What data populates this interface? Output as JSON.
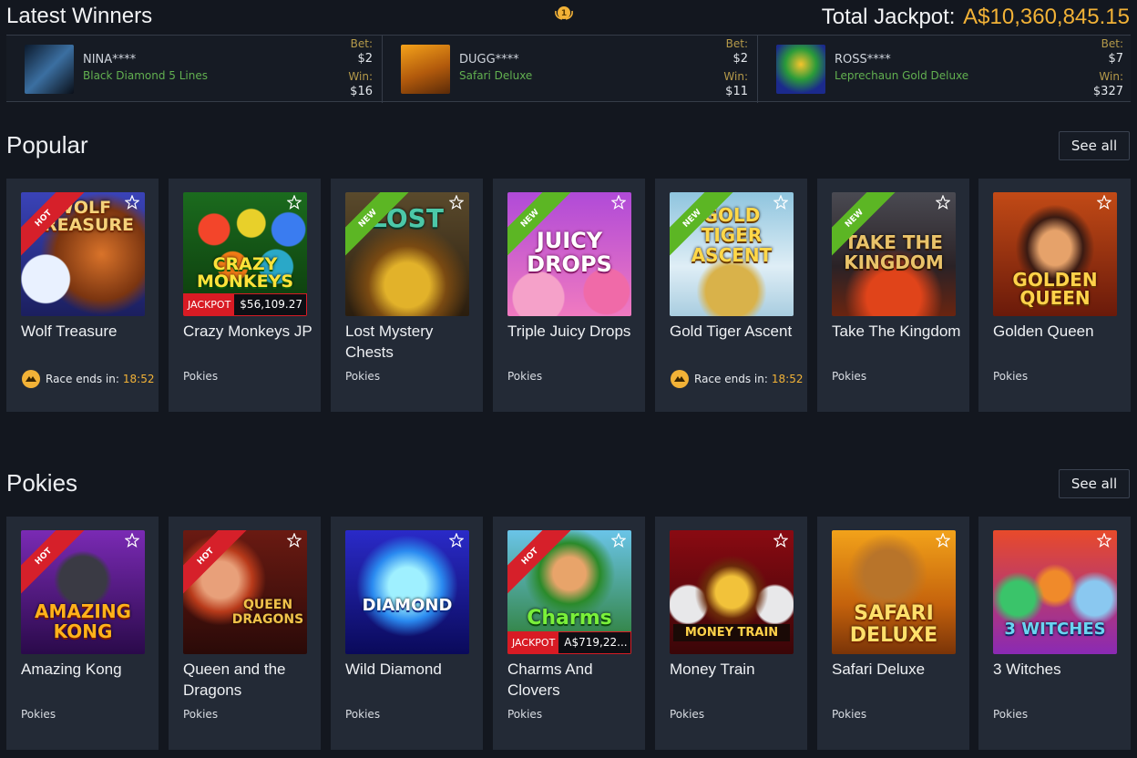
{
  "header": {
    "latest_winners": "Latest Winners",
    "total_jackpot_label": "Total Jackpot:",
    "total_jackpot_amount": "A$10,360,845.15",
    "trophy_icon": "trophy-icon"
  },
  "winners": [
    {
      "name": "NINA****",
      "game": "Black Diamond 5 Lines",
      "bet_label": "Bet:",
      "bet": "$2",
      "win_label": "Win:",
      "win": "$16"
    },
    {
      "name": "DUGG****",
      "game": "Safari Deluxe",
      "bet_label": "Bet:",
      "bet": "$2",
      "win_label": "Win:",
      "win": "$11"
    },
    {
      "name": "ROSS****",
      "game": "Leprechaun Gold Deluxe",
      "bet_label": "Bet:",
      "bet": "$7",
      "win_label": "Win:",
      "win": "$327"
    }
  ],
  "popular": {
    "title": "Popular",
    "see_all": "See all",
    "games": [
      {
        "title": "Wolf Treasure",
        "art": "WOLF TREASURE",
        "ribbon": "HOT",
        "race_label": "Race ends in:",
        "race_time": "18:52"
      },
      {
        "title": "Crazy Monkeys JP",
        "art": "CRAZY MONKEYS",
        "category": "Pokies",
        "jackpot_label": "JACKPOT",
        "jackpot_value": "$56,109.27"
      },
      {
        "title": "Lost Mystery Chests",
        "art": "LOST",
        "ribbon": "NEW",
        "category": "Pokies"
      },
      {
        "title": "Triple Juicy Drops",
        "art": "JUICY DROPS",
        "ribbon": "NEW",
        "category": "Pokies"
      },
      {
        "title": "Gold Tiger Ascent",
        "art": "GOLD TIGER ASCENT",
        "ribbon": "NEW",
        "race_label": "Race ends in:",
        "race_time": "18:52"
      },
      {
        "title": "Take The Kingdom",
        "art": "TAKE THE KINGDOM",
        "ribbon": "NEW",
        "category": "Pokies"
      },
      {
        "title": "Golden Queen",
        "art": "GOLDEN QUEEN",
        "category": "Pokies"
      }
    ]
  },
  "pokies": {
    "title": "Pokies",
    "see_all": "See all",
    "games": [
      {
        "title": "Amazing Kong",
        "art": "AMAZING KONG",
        "ribbon": "HOT",
        "category": "Pokies"
      },
      {
        "title": "Queen and the Dragons",
        "art": "QUEEN DRAGONS",
        "ribbon": "HOT",
        "category": "Pokies"
      },
      {
        "title": "Wild Diamond",
        "art": "DIAMOND",
        "category": "Pokies"
      },
      {
        "title": "Charms And Clovers",
        "art": "Charms",
        "ribbon": "HOT",
        "category": "Pokies",
        "jackpot_label": "JACKPOT",
        "jackpot_value": "A$719,22..."
      },
      {
        "title": "Money Train",
        "art": "MONEY TRAIN",
        "category": "Pokies"
      },
      {
        "title": "Safari Deluxe",
        "art": "SAFARI DELUXE",
        "category": "Pokies"
      },
      {
        "title": "3 Witches",
        "art": "3 WITCHES",
        "category": "Pokies"
      }
    ]
  }
}
